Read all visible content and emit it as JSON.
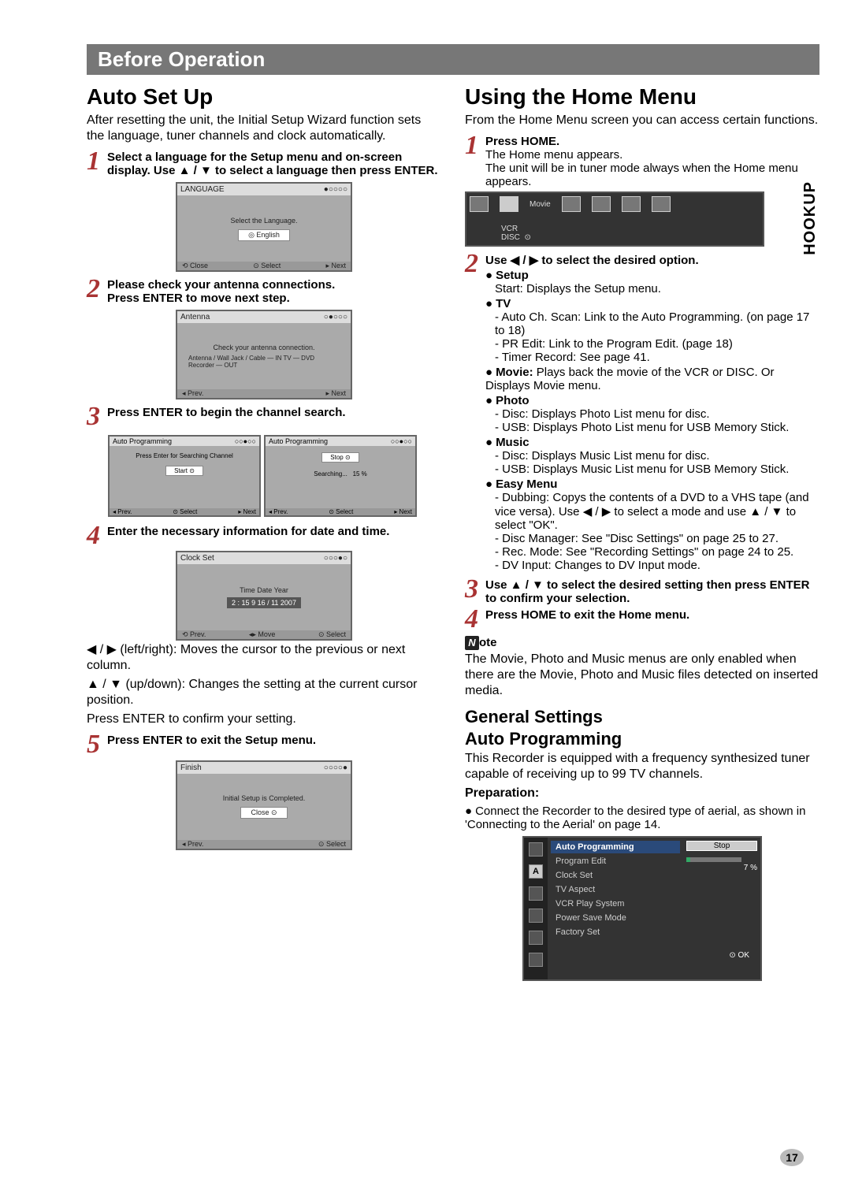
{
  "section_bar": "Before Operation",
  "sidebar_tab": "HOOKUP",
  "page_number": "17",
  "left": {
    "heading": "Auto Set Up",
    "intro": "After resetting the unit, the Initial Setup Wizard function sets the language, tuner channels and clock automatically.",
    "steps": {
      "s1": "Select a language for the Setup menu and on-screen display. Use ▲ / ▼ to select a language then press ENTER.",
      "s2_line1": "Please check your antenna connections.",
      "s2_line2": "Press ENTER to move next step.",
      "s3": "Press ENTER to begin the channel search.",
      "s4": "Enter the necessary information for date and time.",
      "s5": "Press ENTER to exit the Setup menu."
    },
    "post4_p1": "◀ / ▶ (left/right): Moves the cursor to the previous or next column.",
    "post4_p2": "▲ / ▼ (up/down): Changes the setting at the current cursor position.",
    "post4_p3": "Press ENTER to confirm your setting.",
    "shot1": {
      "title": "LANGUAGE",
      "body": "Select the Language.",
      "btn": "◎ English",
      "f1": "⟲ Close",
      "f2": "⊙ Select",
      "f3": "▸ Next"
    },
    "shot2": {
      "title": "Antenna",
      "body": "Check your antenna connection.",
      "labels": "Antenna / Wall Jack / Cable — IN TV — DVD Recorder — OUT",
      "f1": "◂ Prev.",
      "f3": "▸ Next"
    },
    "shot3a": {
      "title": "Auto Programming",
      "body": "Press Enter for Searching Channel",
      "btn": "Start ⊙",
      "f1": "◂ Prev.",
      "f2": "⊙ Select",
      "f3": "▸ Next"
    },
    "shot3b": {
      "title": "Auto Programming",
      "body": "Searching...",
      "btn": "Stop ⊙",
      "prog": "15 %",
      "f1": "◂ Prev.",
      "f2": "⊙ Select",
      "f3": "▸ Next"
    },
    "shot4": {
      "title": "Clock Set",
      "labels": "Time   Date   Year",
      "vals": "2 : 15   9  16 / 11  2007",
      "f1": "⟲ Prev.",
      "f2": "◂▸ Move",
      "f3": "⊙ Select"
    },
    "shot5": {
      "title": "Finish",
      "body": "Initial Setup is Completed.",
      "btn": "Close ⊙",
      "f1": "◂ Prev.",
      "f3": "⊙ Select"
    }
  },
  "right": {
    "heading": "Using the Home Menu",
    "intro": "From the Home Menu screen you can access certain functions.",
    "s1_bold": "Press HOME.",
    "s1_l1": "The Home menu appears.",
    "s1_l2": "The unit will be in tuner mode always when the Home menu appears.",
    "home_shot": {
      "top_label": "Movie",
      "row": "VCR",
      "row_sel": "DISC"
    },
    "s2_bold": "Use ◀ / ▶ to select the desired option.",
    "setup_head": "Setup",
    "setup_l1": "Start: Displays the Setup menu.",
    "tv_head": "TV",
    "tv_l1": "- Auto Ch. Scan: Link to the Auto Programming. (on page 17 to 18)",
    "tv_l2": "- PR Edit: Link to the Program Edit. (page 18)",
    "tv_l3": "- Timer Record: See page 41.",
    "movie_head": "Movie:",
    "movie_l1": " Plays back the movie of the VCR or DISC. Or Displays Movie menu.",
    "photo_head": "Photo",
    "photo_l1": "- Disc: Displays Photo List menu for disc.",
    "photo_l2": "- USB: Displays Photo List menu for USB Memory Stick.",
    "music_head": "Music",
    "music_l1": "- Disc: Displays Music List menu for disc.",
    "music_l2": "- USB: Displays Music List menu for USB Memory Stick.",
    "easy_head": "Easy Menu",
    "easy_l1_a": "- Dubbing: Copys the contents of a DVD to a VHS tape (and vice versa). Use ◀ / ▶ to select a mode and use ▲ / ▼ to select \"OK\".",
    "easy_l2": "- Disc Manager: See \"Disc Settings\" on page 25 to 27.",
    "easy_l3": "- Rec. Mode: See \"Recording Settings\" on page 24 to 25.",
    "easy_l4": "- DV Input: Changes to DV Input mode.",
    "s3_bold": "Use ▲ / ▼ to select the desired setting then press ENTER to confirm your selection.",
    "s4_bold": "Press HOME to exit the Home menu.",
    "note_label": "ote",
    "note_body": "The Movie, Photo and Music menus are only enabled when there are the Movie, Photo and Music files detected on inserted media.",
    "gs_heading": "General Settings",
    "ap_heading": "Auto Programming",
    "ap_intro": "This Recorder is equipped with a frequency synthesized tuner capable of receiving up to 99 TV channels.",
    "prep_head": "Preparation:",
    "prep_l1": "Connect the Recorder to the desired type of aerial, as shown in 'Connecting to the Aerial' on page 14.",
    "menu_shot": {
      "items": [
        "Auto Programming",
        "Program Edit",
        "Clock Set",
        "TV Aspect",
        "VCR Play System",
        "Power Save Mode",
        "Factory Set"
      ],
      "btn": "Stop",
      "progress": "7 %",
      "ok": "⊙ OK"
    }
  }
}
